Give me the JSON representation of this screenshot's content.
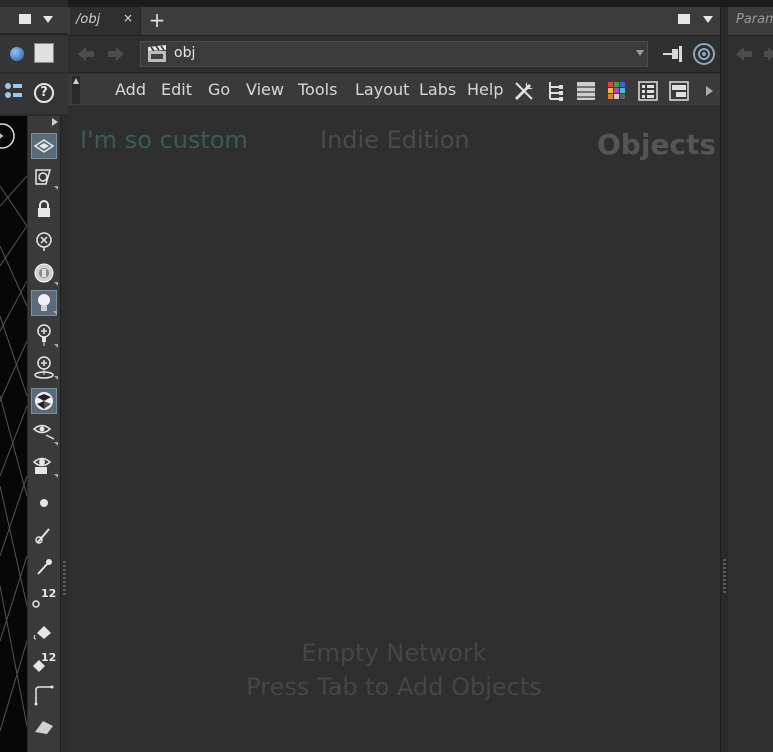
{
  "left_pane": {
    "shelf_icons": [
      "transform-grid-icon",
      "handle-curve-icon",
      "lock-icon",
      "cancel-circle-icon",
      "camera-lens-icon",
      "light-bulb-icon",
      "point-light-icon",
      "spot-light-icon",
      "environment-ball-icon",
      "view-eye-icon",
      "camera-eye-icon",
      "dot-icon",
      "brush-icon",
      "pen-icon",
      "number-point-icon",
      "paint-bucket-icon",
      "number-bucket-icon",
      "angle-curve-icon",
      "shape-icon"
    ],
    "shelf_numbers": [
      "12",
      "12"
    ]
  },
  "network_tab": {
    "label": "/obj",
    "close_glyph": "×",
    "add_glyph": "+"
  },
  "path": {
    "value": "obj"
  },
  "menu": {
    "items": [
      "Add",
      "Edit",
      "Go",
      "View",
      "Tools",
      "Layout",
      "Labs",
      "Help"
    ],
    "toolbar_icons": [
      "tools-icon",
      "tree-view-icon",
      "list-view-icon",
      "color-palette-icon",
      "details-view-icon",
      "network-view-icon"
    ]
  },
  "canvas": {
    "custom_label": "I'm so custom",
    "edition_label": "Indie Edition",
    "context_label": "Objects",
    "empty_line1": "Empty Network",
    "empty_line2": "Press Tab to Add Objects"
  },
  "right_pane": {
    "tab_label": "Param"
  },
  "colors": {
    "accent_active": "#5a6a7a",
    "custom_text": "#3b5a5a"
  }
}
